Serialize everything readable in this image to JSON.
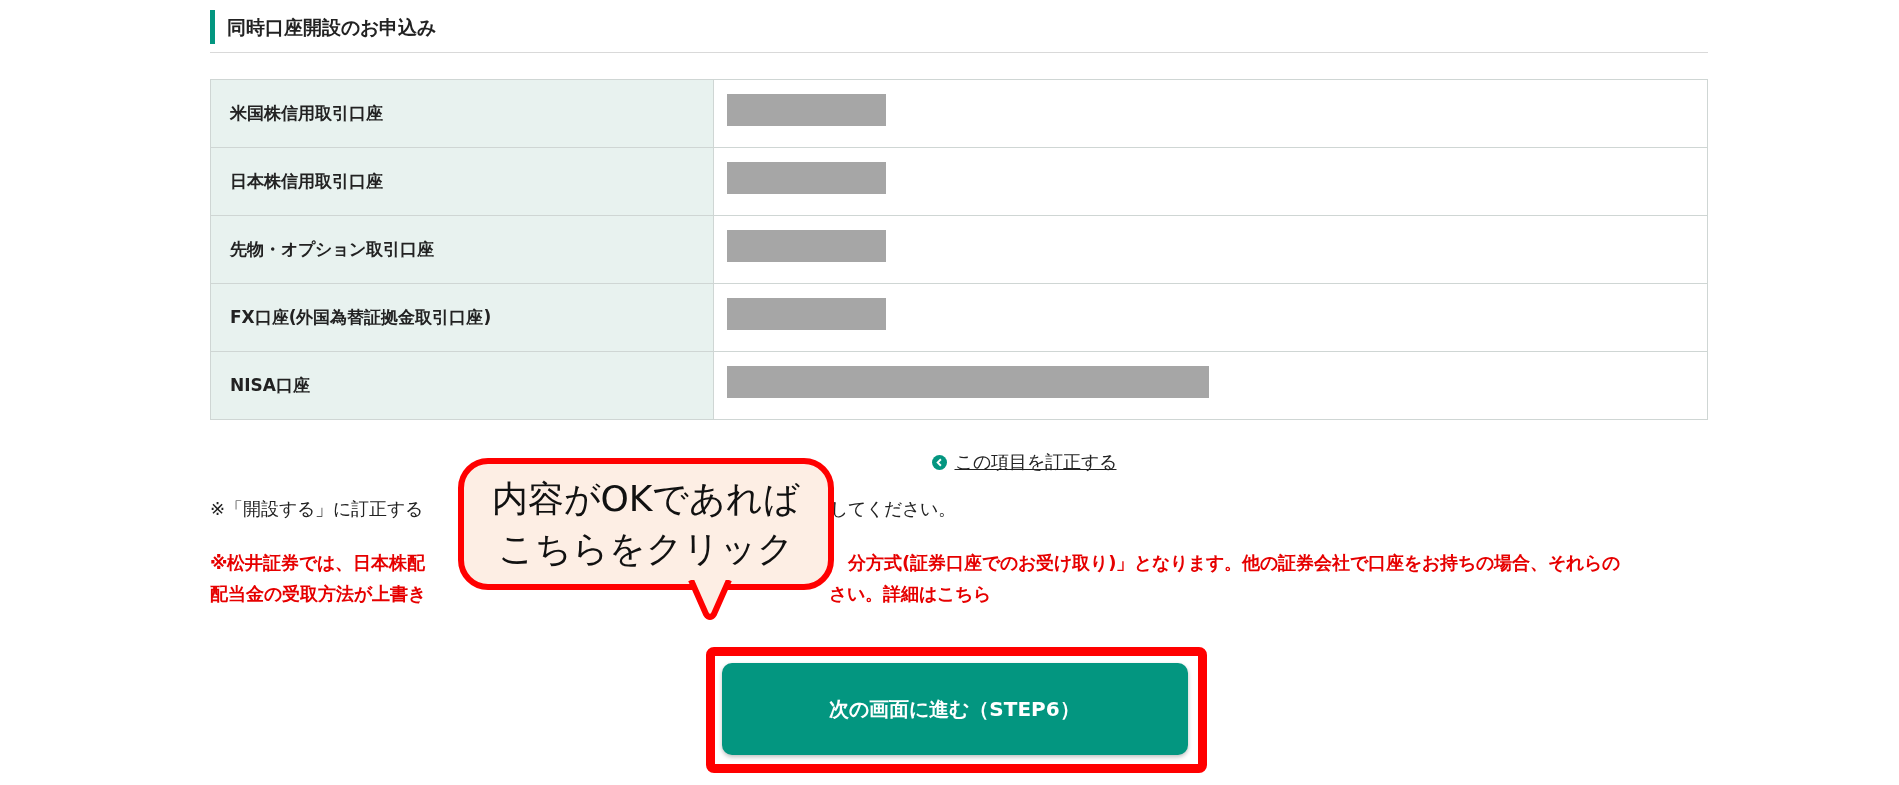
{
  "section_title": "同時口座開設のお申込み",
  "rows": [
    {
      "label": "米国株信用取引口座",
      "kind": "short"
    },
    {
      "label": "日本株信用取引口座",
      "kind": "short"
    },
    {
      "label": "先物・オプション取引口座",
      "kind": "short"
    },
    {
      "label": "FX口座(外国為替証拠金取引口座)",
      "kind": "short"
    },
    {
      "label": "NISA口座",
      "kind": "long"
    }
  ],
  "correct_link": "この項目を訂正する",
  "note": {
    "left": "※「開設する」に訂正する",
    "right": "してください。"
  },
  "warning_lines": [
    {
      "left": "※松井証券では、日本株配",
      "right": "分方式(証券口座でのお受け取り)」となります。他の証券会社で口座をお持ちの場合、それらの"
    },
    {
      "left": "配当金の受取方法が上書き",
      "right": "さい。詳細はこちら"
    }
  ],
  "callout": [
    "内容がOKであれば",
    "こちらをクリック"
  ],
  "next_button": "次の画面に進む（STEP6）"
}
